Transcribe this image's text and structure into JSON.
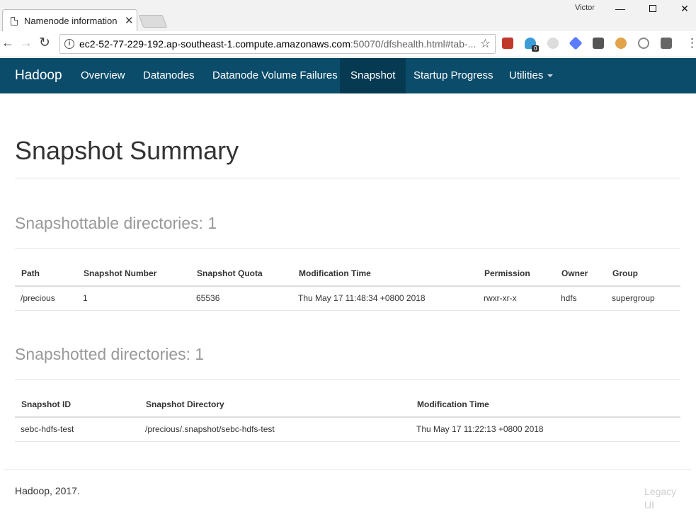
{
  "browser": {
    "tab_title": "Namenode information",
    "tab_close": "✕",
    "profile_name": "Victor",
    "window_controls": {
      "minimize": "—",
      "close": "✕"
    },
    "url_host": "ec2-52-77-229-192.ap-southeast-1.compute.amazonaws.com",
    "url_rest": ":50070/dfshealth.html#tab-...",
    "extension_badge": "0",
    "icons": [
      "page-icon",
      "back-arrow-icon",
      "forward-arrow-icon",
      "reload-icon",
      "info-icon",
      "star-icon",
      "kebab-menu-icon"
    ]
  },
  "navbar": {
    "brand": "Hadoop",
    "items": [
      {
        "label": "Overview"
      },
      {
        "label": "Datanodes"
      },
      {
        "label": "Datanode Volume Failures"
      },
      {
        "label": "Snapshot",
        "active": true
      },
      {
        "label": "Startup Progress"
      },
      {
        "label": "Utilities"
      }
    ],
    "colors": {
      "background": "#0b4c6a",
      "active": "#063a52"
    }
  },
  "page": {
    "title": "Snapshot Summary"
  },
  "snapshottable": {
    "heading": "Snapshottable directories: 1",
    "columns": [
      "Path",
      "Snapshot Number",
      "Snapshot Quota",
      "Modification Time",
      "Permission",
      "Owner",
      "Group"
    ],
    "rows": [
      [
        "/precious",
        "1",
        "65536",
        "Thu May 17 11:48:34 +0800 2018",
        "rwxr-xr-x",
        "hdfs",
        "supergroup"
      ]
    ]
  },
  "snapshotted": {
    "heading": "Snapshotted directories: 1",
    "columns": [
      "Snapshot ID",
      "Snapshot Directory",
      "Modification Time"
    ],
    "rows": [
      [
        "sebc-hdfs-test",
        "/precious/.snapshot/sebc-hdfs-test",
        "Thu May 17 11:22:13 +0800 2018"
      ]
    ]
  },
  "footer": {
    "text": "Hadoop, 2017.",
    "legacy_link": "Legacy UI"
  }
}
